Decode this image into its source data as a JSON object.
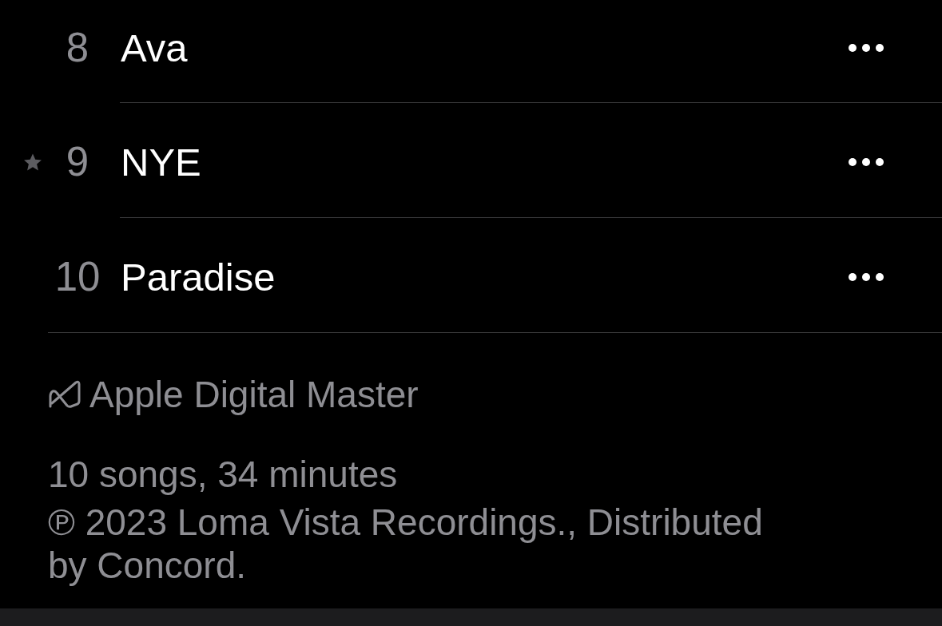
{
  "tracks": [
    {
      "number": "8",
      "title": "Ava",
      "starred": false
    },
    {
      "number": "9",
      "title": "NYE",
      "starred": true
    },
    {
      "number": "10",
      "title": "Paradise",
      "starred": false
    }
  ],
  "footer": {
    "badge": "Apple Digital Master",
    "summary": "10 songs, 34 minutes",
    "copyright": "℗ 2023 Loma Vista Recordings., Distributed by Concord."
  }
}
